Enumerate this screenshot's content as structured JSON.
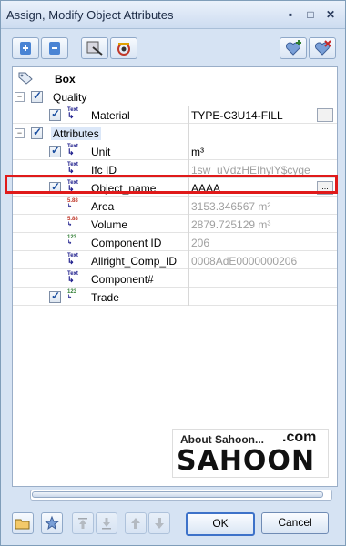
{
  "window": {
    "title": "Assign, Modify Object Attributes"
  },
  "tree": {
    "root_label": "Box",
    "quality_label": "Quality",
    "attributes_label": "Attributes",
    "rows": [
      {
        "label": "Material",
        "value": "TYPE-C3U14-FILL",
        "checked": true,
        "icon": "Text",
        "value_gray": false,
        "has_ellipsis": true
      },
      {
        "label": "Unit",
        "value": "m³",
        "checked": true,
        "icon": "Text",
        "value_gray": false,
        "has_ellipsis": false
      },
      {
        "label": "Ifc ID",
        "value": "1sw_uVdzHEIhylY$cyge",
        "checked": false,
        "icon": "Text",
        "value_gray": true,
        "has_ellipsis": false
      },
      {
        "label": "Object_name",
        "value": "AAAA",
        "checked": true,
        "icon": "Text",
        "value_gray": false,
        "has_ellipsis": true
      },
      {
        "label": "Area",
        "value": "3153.346567 m²",
        "checked": false,
        "icon": "5.88",
        "value_gray": true,
        "has_ellipsis": false
      },
      {
        "label": "Volume",
        "value": "2879.725129 m³",
        "checked": false,
        "icon": "5.88",
        "value_gray": true,
        "has_ellipsis": false
      },
      {
        "label": "Component ID",
        "value": "206",
        "checked": false,
        "icon": "123",
        "value_gray": true,
        "has_ellipsis": false
      },
      {
        "label": "Allright_Comp_ID",
        "value": "0008AdE0000000206",
        "checked": false,
        "icon": "Text",
        "value_gray": true,
        "has_ellipsis": false
      },
      {
        "label": "Component#",
        "value": "",
        "checked": false,
        "icon": "Text",
        "value_gray": false,
        "has_ellipsis": false
      },
      {
        "label": "Trade",
        "value": "",
        "checked": true,
        "icon": "123",
        "value_gray": false,
        "has_ellipsis": false
      }
    ],
    "ellipsis": "..."
  },
  "buttons": {
    "ok": "OK",
    "cancel": "Cancel"
  },
  "logo": {
    "about": "About Sahoon...",
    "com": ".com",
    "brand": "SAHOON"
  },
  "colors": {
    "highlight": "#e01a1a",
    "accent": "#3d72c9"
  }
}
